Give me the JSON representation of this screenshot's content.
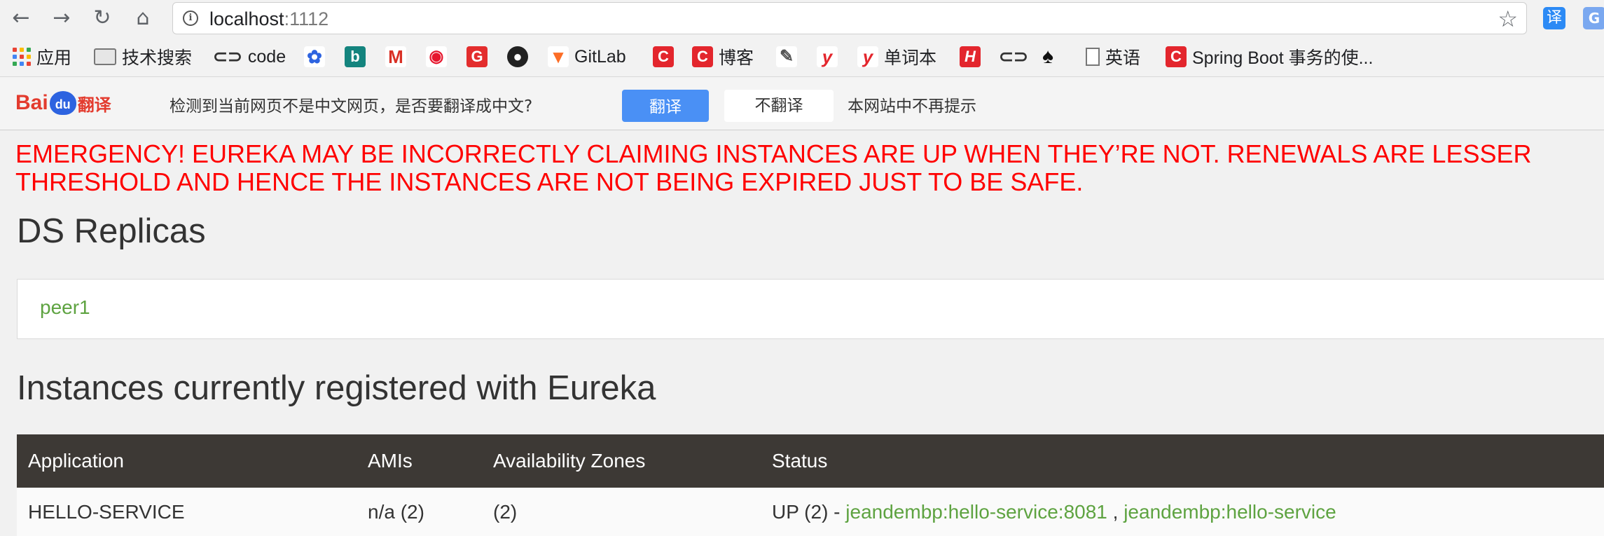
{
  "browser": {
    "url_host": "localhost",
    "url_port": ":1112",
    "nav": {
      "back": "←",
      "forward": "→",
      "reload": "↻",
      "home": "⌂"
    },
    "star_icon": "☆",
    "ext_translate_label": "译",
    "ext_google_label": "G"
  },
  "bookmarks": {
    "apps": "应用",
    "tech_search": "技术搜索",
    "code": "code",
    "gitlab": "GitLab",
    "blog": "博客",
    "wordbook": "单词本",
    "english": "英语",
    "spring": "Spring Boot 事务的使..."
  },
  "translate_bar": {
    "logo_bai": "Bai",
    "logo_du": "du",
    "logo_fanyi": "翻译",
    "message": "检测到当前网页不是中文网页，是否要翻译成中文?",
    "translate_button": "翻译",
    "no_translate_button": "不翻译",
    "never_prompt": "本网站中不再提示"
  },
  "page": {
    "emergency_line1": "EMERGENCY! EUREKA MAY BE INCORRECTLY CLAIMING INSTANCES ARE UP WHEN THEY’RE NOT. RENEWALS ARE LESSER",
    "emergency_line2": "THRESHOLD AND HENCE THE INSTANCES ARE NOT BEING EXPIRED JUST TO BE SAFE.",
    "ds_replicas_title": "DS Replicas",
    "replicas": [
      "peer1"
    ],
    "instances_title": "Instances currently registered with Eureka",
    "table": {
      "headers": [
        "Application",
        "AMIs",
        "Availability Zones",
        "Status"
      ],
      "rows": [
        {
          "application": "HELLO-SERVICE",
          "amis": "n/a (2)",
          "zones": "(2)",
          "status_prefix": "UP (2) - ",
          "links": [
            "jeandembp:hello-service:8081",
            "jeandembp:hello-service"
          ],
          "separator": " , "
        }
      ]
    }
  },
  "colors": {
    "emergency_red": "#ff0000",
    "link_green": "#5ea341",
    "table_header_bg": "#3d3935",
    "baidu_blue": "#4a90f5"
  }
}
